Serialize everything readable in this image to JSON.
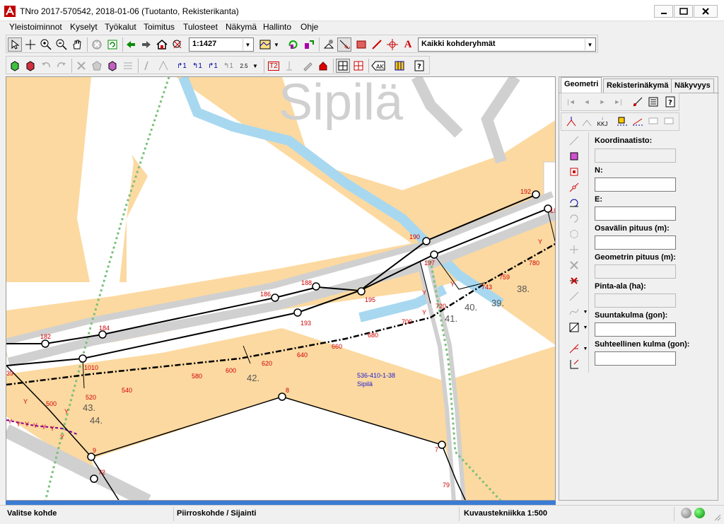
{
  "window": {
    "title": "TNro 2017-570542, 2018-01-06 (Tuotanto, Rekisterikanta)"
  },
  "menu": [
    "Yleistoiminnot",
    "Kyselyt",
    "Työkalut",
    "Toimitus",
    "Tulosteet",
    "Näkymä",
    "Hallinto",
    "Ohje"
  ],
  "toolbar": {
    "scale": "1:1427",
    "group": "Kaikki kohderyhmät"
  },
  "panel": {
    "tabs": [
      "Geometri",
      "Rekisterinäkymä",
      "Näkyvyys"
    ],
    "kkj_label": "KKJ",
    "fields": [
      {
        "label": "Koordinaatisto:",
        "value": ""
      },
      {
        "label": "N:",
        "value": ""
      },
      {
        "label": "E:",
        "value": ""
      },
      {
        "label": "Osavälin pituus (m):",
        "value": ""
      },
      {
        "label": "Geometrin pituus (m):",
        "value": ""
      },
      {
        "label": "Pinta-ala (ha):",
        "value": ""
      },
      {
        "label": "Suuntakulma (gon):",
        "value": ""
      },
      {
        "label": "Suhteellinen kulma (gon):",
        "value": ""
      }
    ]
  },
  "map": {
    "place_name": "Sipilä",
    "property_id": "536-410-1-38",
    "property_name": "Sipilä",
    "parcel_numbers": [
      "42.",
      "43.",
      "44.",
      "41.",
      "40.",
      "39.",
      "38."
    ],
    "point_labels": [
      "182",
      "184",
      "186",
      "188",
      "190",
      "192",
      "193",
      "195",
      "197",
      "1010",
      "8",
      "9",
      "7",
      "72",
      "79",
      "19"
    ],
    "chainage_labels": [
      "520",
      "540",
      "580",
      "600",
      "620",
      "640",
      "660",
      "680",
      "700",
      "720",
      "743",
      "759",
      "780",
      "500"
    ],
    "y_marks": [
      "Y",
      "Y",
      "Y",
      "Y",
      "Y",
      "Y",
      "Y",
      "Y",
      "Y",
      "Y",
      "Y",
      "Y",
      "Y"
    ],
    "edge_label": "39"
  },
  "status": {
    "left": "Valitse kohde",
    "middle": "Piirroskohde / Sijainti",
    "right": "Kuvaustekniikka 1:500"
  },
  "colors": {
    "parcel_fill": "#fcd9a0",
    "road": "#c8c8c8",
    "water": "#a8d8f0",
    "point_label": "#d00000",
    "property": "#1a1ad0"
  }
}
